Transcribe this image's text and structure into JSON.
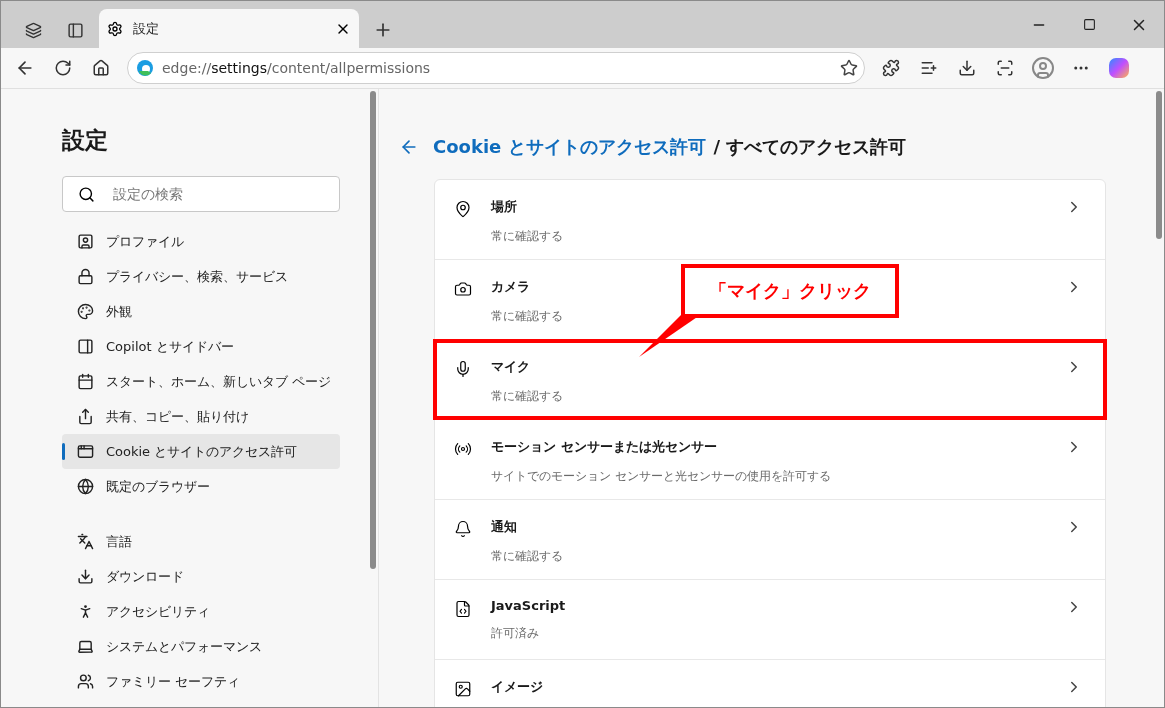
{
  "browser": {
    "tab": {
      "title": "設定",
      "selected": true
    },
    "address": "edge://**settings**/content/allpermissions"
  },
  "sidebar": {
    "title": "設定",
    "search": {
      "placeholder": "設定の検索"
    },
    "groups": [
      {
        "items": [
          {
            "label": "プロファイル",
            "selected": false
          },
          {
            "label": "プライバシー、検索、サービス",
            "selected": false
          },
          {
            "label": "外観",
            "selected": false
          },
          {
            "label": "Copilot とサイドバー",
            "selected": false
          },
          {
            "label": "スタート、ホーム、新しいタブ ページ",
            "selected": false
          },
          {
            "label": "共有、コピー、貼り付け",
            "selected": false
          },
          {
            "label": "Cookie とサイトのアクセス許可",
            "selected": true
          },
          {
            "label": "既定のブラウザー",
            "selected": false
          }
        ]
      },
      {
        "items": [
          {
            "label": "言語",
            "selected": false
          },
          {
            "label": "ダウンロード",
            "selected": false
          },
          {
            "label": "アクセシビリティ",
            "selected": false
          },
          {
            "label": "システムとパフォーマンス",
            "selected": false
          },
          {
            "label": "ファミリー セーフティ",
            "selected": false
          }
        ]
      }
    ]
  },
  "page": {
    "breadcrumb_link": "Cookie とサイトのアクセス許可",
    "breadcrumb_current": "/ すべてのアクセス許可",
    "permissions": [
      {
        "title": "場所",
        "status": "常に確認する",
        "highlighted": false
      },
      {
        "title": "カメラ",
        "status": "常に確認する",
        "highlighted": false
      },
      {
        "title": "マイク",
        "status": "常に確認する",
        "highlighted": true
      },
      {
        "title": "モーション センサーまたは光センサー",
        "status": "サイトでのモーション センサーと光センサーの使用を許可する",
        "highlighted": false
      },
      {
        "title": "通知",
        "status": "常に確認する",
        "highlighted": false
      },
      {
        "title": "JavaScript",
        "status": "許可済み",
        "highlighted": false
      },
      {
        "title": "イメージ",
        "highlighted": false
      }
    ]
  },
  "annotation": {
    "callout": "「マイク」クリック"
  }
}
